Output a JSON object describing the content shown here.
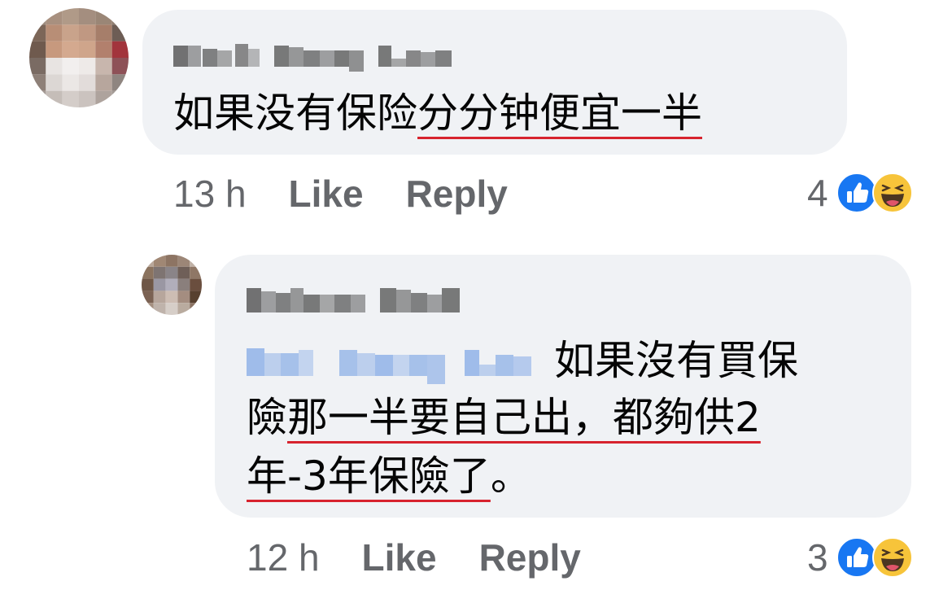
{
  "comments": [
    {
      "author_name_pixelated": "Patt Hong Lee",
      "text_plain": "如果没有保险",
      "text_underlined": "分分钟便宜一半",
      "time": "13 h",
      "like_label": "Like",
      "reply_label": "Reply",
      "reaction_count": "4",
      "reaction_icons": [
        "like-icon",
        "haha-icon"
      ]
    },
    {
      "author_name_pixelated": "Kelsee Chok",
      "mention_pixelated": "Patt Hong Lee",
      "line1_text": "如果沒有買保",
      "line2_plain": "險",
      "line2_underlined": "那一半要自己出，都夠供2",
      "line3_underlined": "年-3年保險了",
      "line3_plain": "。",
      "time": "12 h",
      "like_label": "Like",
      "reply_label": "Reply",
      "reaction_count": "3",
      "reaction_icons": [
        "like-icon",
        "haha-icon"
      ]
    }
  ],
  "colors": {
    "bubble": "#f0f2f5",
    "meta_text": "#65676b",
    "underline_annotation": "#d7232e",
    "like_blue": "#1877f2",
    "haha_yellow": "#f7c43a"
  }
}
